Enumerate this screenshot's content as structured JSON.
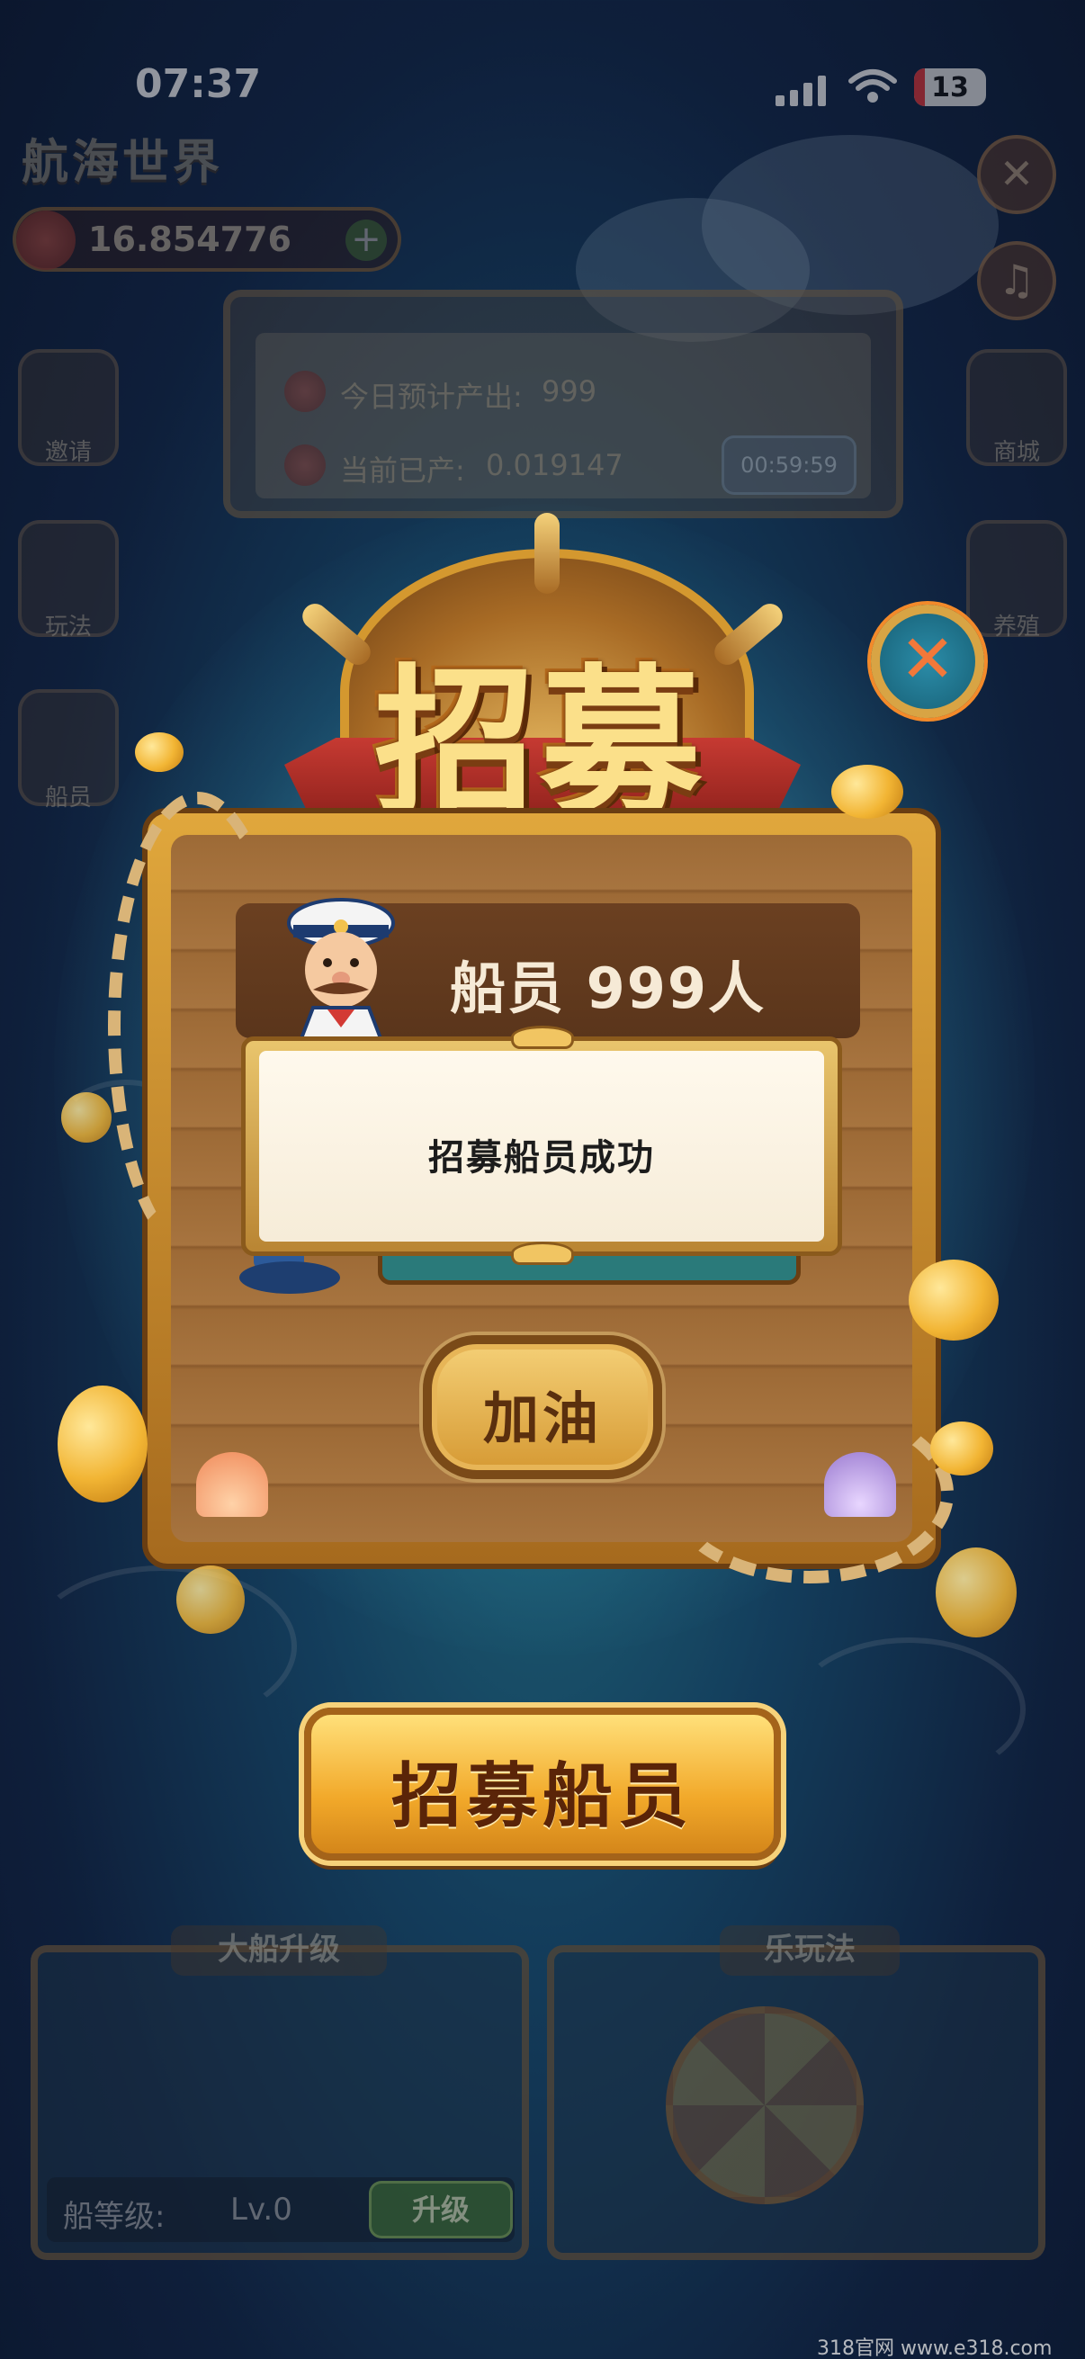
{
  "status_bar": {
    "time": "07:37",
    "battery": "13"
  },
  "background": {
    "game_title": "航海世界",
    "balance": "16.854776",
    "output_panel": {
      "today_label": "今日预计产出:",
      "today_value": "999",
      "current_label": "当前已产:",
      "current_value": "0.019147",
      "timer": "00:59:59"
    },
    "side_left": [
      "邀请",
      "玩法",
      "船员"
    ],
    "side_right": [
      "商城",
      "养殖"
    ],
    "cards": {
      "ship_upgrade": {
        "title": "大船升级",
        "level_label": "船等级:",
        "level_value": "Lv.0",
        "upgrade_button": "升级"
      },
      "fun_play": {
        "title": "乐玩法"
      }
    }
  },
  "modal": {
    "title": "招募",
    "crew_text": "船员 999人",
    "toast": "招募船员成功",
    "fuel_button": "加油",
    "recruit_button": "招募船员"
  },
  "watermark": "318官网 www.e318.com"
}
